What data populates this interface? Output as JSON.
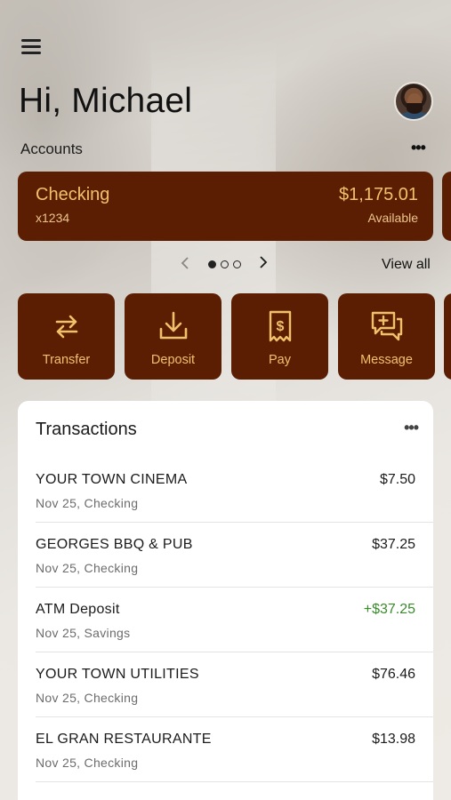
{
  "header": {
    "menu_icon": "hamburger-menu-icon",
    "greeting": "Hi, Michael",
    "avatar_icon": "user-avatar"
  },
  "accounts": {
    "label": "Accounts",
    "more_icon": "more-horizontal-icon",
    "card": {
      "name": "Checking",
      "mask": "x1234",
      "balance": "$1,175.01",
      "balance_label": "Available"
    },
    "pager": {
      "total": 3,
      "active": 1
    },
    "view_all": "View all"
  },
  "actions": [
    {
      "label": "Transfer",
      "icon": "transfer-arrows-icon"
    },
    {
      "label": "Deposit",
      "icon": "deposit-download-icon"
    },
    {
      "label": "Pay",
      "icon": "pay-bill-icon"
    },
    {
      "label": "Message",
      "icon": "message-plus-icon"
    }
  ],
  "transactions": {
    "title": "Transactions",
    "items": [
      {
        "name": "YOUR TOWN CINEMA",
        "meta": "Nov 25, Checking",
        "amount": "$7.50",
        "credit": false
      },
      {
        "name": "GEORGES BBQ & PUB",
        "meta": "Nov 25, Checking",
        "amount": "$37.25",
        "credit": false
      },
      {
        "name": "ATM Deposit",
        "meta": "Nov 25, Savings",
        "amount": "+$37.25",
        "credit": true
      },
      {
        "name": "YOUR TOWN UTILITIES",
        "meta": "Nov 25, Checking",
        "amount": "$76.46",
        "credit": false
      },
      {
        "name": "EL GRAN RESTAURANTE",
        "meta": "Nov 25, Checking",
        "amount": "$13.98",
        "credit": false
      }
    ]
  },
  "colors": {
    "brand": "#5b1e03",
    "accent": "#f1c06b",
    "credit": "#3a8a2c"
  }
}
